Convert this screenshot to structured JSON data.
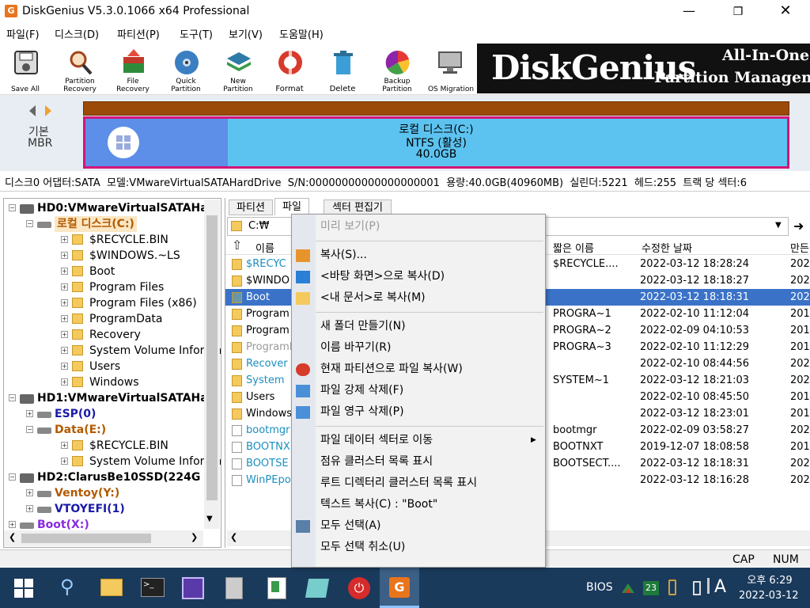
{
  "window": {
    "title": "DiskGenius V5.3.0.1066 x64 Professional"
  },
  "menu": [
    "파일(F)",
    "디스크(D)",
    "파티션(P)",
    "도구(T)",
    "보기(V)",
    "도움말(H)"
  ],
  "toolbar": [
    {
      "label": "Save All",
      "icon": "save-icon"
    },
    {
      "label": "Partition\nRecovery",
      "icon": "magnifier-icon"
    },
    {
      "label": "File\nRecovery",
      "icon": "file-recovery-icon"
    },
    {
      "label": "Quick\nPartition",
      "icon": "disc-icon"
    },
    {
      "label": "New\nPartition",
      "icon": "layers-icon"
    },
    {
      "label": "Format",
      "icon": "format-icon"
    },
    {
      "label": "Delete",
      "icon": "trash-icon"
    },
    {
      "label": "Backup\nPartition",
      "icon": "backup-icon"
    },
    {
      "label": "OS Migration",
      "icon": "os-migration-icon"
    }
  ],
  "banner": {
    "logo": "DiskGenius",
    "tagline1": "All-In-One So",
    "tagline2": "Partition Managemen"
  },
  "disk_panel": {
    "nav_label1": "기본",
    "nav_label2": "MBR",
    "partition_name": "로컬 디스크(C:)",
    "partition_fs": "NTFS (활성)",
    "partition_size": "40.0GB"
  },
  "disk_info": "디스크0 어댑터:SATA  모델:VMwareVirtualSATAHardDrive  S/N:00000000000000000001  용량:40.0GB(40960MB)  실린더:5221  헤드:255  트랙 당 섹터:6",
  "tree": [
    {
      "text": "HD0:VMwareVirtualSATAHar",
      "level": 0,
      "kind": "disk",
      "bold": true
    },
    {
      "text": "로컬 디스크(C:)",
      "level": 1,
      "kind": "part",
      "color": "#b35a00",
      "selected": true
    },
    {
      "text": "$RECYCLE.BIN",
      "level": 2,
      "kind": "folder"
    },
    {
      "text": "$WINDOWS.~LS",
      "level": 2,
      "kind": "folder"
    },
    {
      "text": "Boot",
      "level": 2,
      "kind": "folder"
    },
    {
      "text": "Program Files",
      "level": 2,
      "kind": "folder"
    },
    {
      "text": "Program Files (x86)",
      "level": 2,
      "kind": "folder"
    },
    {
      "text": "ProgramData",
      "level": 2,
      "kind": "folder"
    },
    {
      "text": "Recovery",
      "level": 2,
      "kind": "folder"
    },
    {
      "text": "System Volume Informat",
      "level": 2,
      "kind": "folder"
    },
    {
      "text": "Users",
      "level": 2,
      "kind": "folder"
    },
    {
      "text": "Windows",
      "level": 2,
      "kind": "folder"
    },
    {
      "text": "HD1:VMwareVirtualSATAHar",
      "level": 0,
      "kind": "disk",
      "bold": true
    },
    {
      "text": "ESP(0)",
      "level": 1,
      "kind": "part",
      "color": "#1a1aa8"
    },
    {
      "text": "Data(E:)",
      "level": 1,
      "kind": "part",
      "color": "#b35a00"
    },
    {
      "text": "$RECYCLE.BIN",
      "level": 2,
      "kind": "folder"
    },
    {
      "text": "System Volume Informat",
      "level": 2,
      "kind": "folder"
    },
    {
      "text": "HD2:ClarusBe10SSD(224G",
      "level": 0,
      "kind": "disk",
      "bold": true
    },
    {
      "text": "Ventoy(Y:)",
      "level": 1,
      "kind": "part",
      "color": "#b35a00"
    },
    {
      "text": "VTOYEFI(1)",
      "level": 1,
      "kind": "part",
      "color": "#1a1aa8"
    },
    {
      "text": "Boot(X:)",
      "level": 0,
      "kind": "part",
      "color": "#8a2be2"
    }
  ],
  "tabs": [
    "파티션",
    "파일",
    "섹터 편집기"
  ],
  "path": "C:₩",
  "columns": {
    "name": "이름",
    "short": "짧은 이름",
    "modified": "수정한 날짜",
    "created": "만든"
  },
  "files": [
    {
      "name": "$RECYC",
      "short": "$RECYCLE....",
      "modified": "2022-03-12 18:28:24",
      "created": "202",
      "color": "#1a8fbf"
    },
    {
      "name": "$WINDO",
      "short": "",
      "modified": "2022-03-12 18:18:27",
      "created": "202",
      "color": "#000"
    },
    {
      "name": "Boot",
      "short": "",
      "modified": "2022-03-12 18:18:31",
      "created": "202",
      "color": "#000",
      "selected": true
    },
    {
      "name": "Program",
      "short": "PROGRA~1",
      "modified": "2022-02-10 11:12:04",
      "created": "201",
      "color": "#000"
    },
    {
      "name": "Program",
      "short": "PROGRA~2",
      "modified": "2022-02-09 04:10:53",
      "created": "201",
      "color": "#000"
    },
    {
      "name": "Programl",
      "short": "PROGRA~3",
      "modified": "2022-02-10 11:12:29",
      "created": "201",
      "color": "#999"
    },
    {
      "name": "Recover",
      "short": "",
      "modified": "2022-02-10 08:44:56",
      "created": "202",
      "color": "#1a8fbf"
    },
    {
      "name": "System",
      "short": "SYSTEM~1",
      "modified": "2022-03-12 18:21:03",
      "created": "202",
      "color": "#1a8fbf"
    },
    {
      "name": "Users",
      "short": "",
      "modified": "2022-02-10 08:45:50",
      "created": "201",
      "color": "#000"
    },
    {
      "name": "Windows",
      "short": "",
      "modified": "2022-03-12 18:23:01",
      "created": "201",
      "color": "#000"
    },
    {
      "name": "bootmgr",
      "short": "bootmgr",
      "modified": "2022-02-09 03:58:27",
      "created": "202",
      "color": "#1a8fbf"
    },
    {
      "name": "BOOTNX",
      "short": "BOOTNXT",
      "modified": "2019-12-07 18:08:58",
      "created": "201",
      "color": "#1a8fbf"
    },
    {
      "name": "BOOTSE",
      "short": "BOOTSECT....",
      "modified": "2022-03-12 18:18:31",
      "created": "202",
      "color": "#1a8fbf"
    },
    {
      "name": "WinPEpo",
      "short": "",
      "modified": "2022-03-12 18:16:28",
      "created": "202",
      "color": "#1a8fbf"
    }
  ],
  "context_menu": [
    {
      "label": "미리 보기(P)",
      "disabled": true
    },
    {
      "sep": true
    },
    {
      "label": "복사(S)...",
      "icon": "copy-arrow-icon"
    },
    {
      "label": "<바탕 화면>으로 복사(D)",
      "icon": "desktop-icon"
    },
    {
      "label": "<내 문서>로 복사(M)",
      "icon": "folder-open-icon"
    },
    {
      "sep": true
    },
    {
      "label": "새 폴더 만들기(N)"
    },
    {
      "label": "이름 바꾸기(R)"
    },
    {
      "label": "현재 파티션으로 파일 복사(W)",
      "icon": "pie-icon"
    },
    {
      "label": "파일 강제 삭제(F)",
      "icon": "delete-doc-icon"
    },
    {
      "label": "파일 영구 삭제(P)",
      "icon": "shredder-icon"
    },
    {
      "sep": true
    },
    {
      "label": "파일 데이터 섹터로 이동",
      "submenu": true
    },
    {
      "label": "점유 클러스터 목록 표시"
    },
    {
      "label": "루트 디렉터리 클러스터 목록 표시"
    },
    {
      "label": "텍스트 복사(C) : \"Boot\""
    },
    {
      "label": "모두 선택(A)",
      "icon": "checkbox-icon"
    },
    {
      "label": "모두 선택 취소(U)"
    }
  ],
  "status": {
    "cap": "CAP",
    "num": "NUM"
  },
  "taskbar": {
    "tray_label": "BIOS",
    "badge": "23",
    "ime": "A",
    "time": "오후 6:29",
    "date": "2022-03-12"
  }
}
